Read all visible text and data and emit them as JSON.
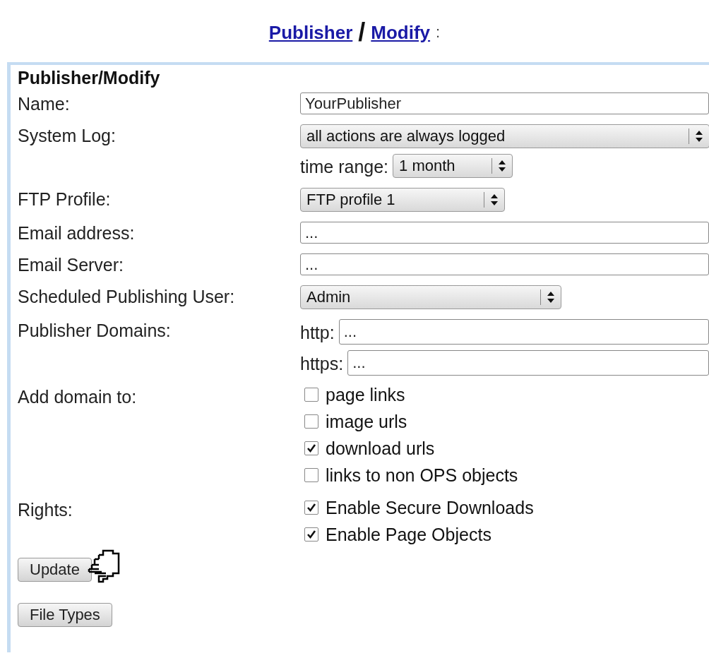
{
  "breadcrumb": {
    "links": [
      "Publisher",
      "Modify"
    ],
    "separator": "/",
    "suffix": ":"
  },
  "panel": {
    "title": "Publisher/Modify",
    "rows": [
      {
        "label": "Name:",
        "kind": "text",
        "value": "YourPublisher"
      },
      {
        "label": "System Log:",
        "kind": "select",
        "value": "all actions are always logged",
        "sub": {
          "label": "time range:",
          "value": "1 month"
        }
      },
      {
        "label": "FTP Profile:",
        "kind": "select",
        "value": "FTP profile 1"
      },
      {
        "label": "Email address:",
        "kind": "text",
        "value": "..."
      },
      {
        "label": "Email Server:",
        "kind": "text",
        "value": "..."
      },
      {
        "label": "Scheduled Publishing User:",
        "kind": "select",
        "value": "Admin"
      },
      {
        "label": "Publisher Domains:",
        "kind": "prefixed",
        "fields": [
          {
            "prefix": "http:",
            "value": "..."
          },
          {
            "prefix": "https:",
            "value": "..."
          }
        ]
      },
      {
        "label": "Add domain to:",
        "kind": "checks",
        "options": [
          {
            "label": "page links",
            "checked": false
          },
          {
            "label": "image urls",
            "checked": false
          },
          {
            "label": "download urls",
            "checked": true
          },
          {
            "label": "links to non OPS objects",
            "checked": false
          }
        ]
      },
      {
        "label": "Rights:",
        "kind": "checks",
        "options": [
          {
            "label": "Enable Secure Downloads",
            "checked": true
          },
          {
            "label": "Enable Page Objects",
            "checked": true
          }
        ]
      }
    ],
    "buttons": [
      {
        "label": "Update",
        "pointer": true
      },
      {
        "label": "File Types",
        "pointer": false
      }
    ]
  }
}
